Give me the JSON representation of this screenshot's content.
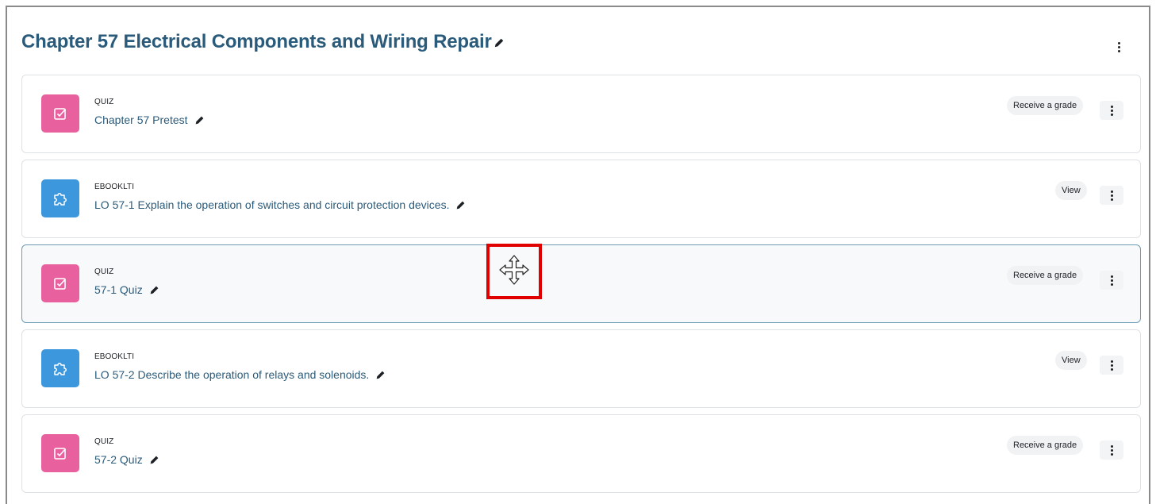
{
  "section": {
    "title": "Chapter 57 Electrical Components and Wiring Repair"
  },
  "activities": [
    {
      "type": "QUIZ",
      "name": "Chapter 57 Pretest",
      "badge": "Receive a grade",
      "icon": "quiz-icon"
    },
    {
      "type": "EBOOKLTI",
      "name": "LO 57-1 Explain the operation of switches and circuit protection devices.",
      "badge": "View",
      "icon": "puzzle-icon"
    },
    {
      "type": "QUIZ",
      "name": "57-1 Quiz",
      "badge": "Receive a grade",
      "icon": "quiz-icon"
    },
    {
      "type": "EBOOKLTI",
      "name": "LO 57-2 Describe the operation of relays and solenoids.",
      "badge": "View",
      "icon": "puzzle-icon"
    },
    {
      "type": "QUIZ",
      "name": "57-2 Quiz",
      "badge": "Receive a grade",
      "icon": "quiz-icon"
    }
  ],
  "colors": {
    "quiz_icon_bg": "#e8619e",
    "ebook_icon_bg": "#3d97dc",
    "title": "#2b5b7a",
    "highlight_outline": "#e00000"
  },
  "cursor": {
    "icon": "move-cursor-icon"
  }
}
